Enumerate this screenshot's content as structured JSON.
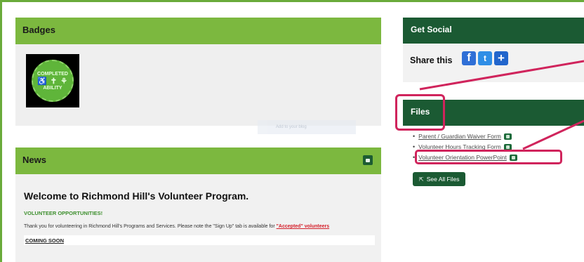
{
  "badges": {
    "title": "Badges",
    "badge_top_text": "COMPLETED",
    "badge_glyphs": "♿ ✝ ⚘",
    "badge_bottom_text": "ABILITY",
    "faded_button": "Add to your blog"
  },
  "news": {
    "title": "News",
    "headline": "Welcome to Richmond Hill's Volunteer Program.",
    "section_label": "VOLUNTEER OPPORTUNITIES!",
    "body_text": "Thank you for volunteering in Richmond Hill's Programs and Services. Please note the \"Sign Up\" tab is available for ",
    "accepted_link": "\"Accepted\" volunteers",
    "coming_soon": "COMING SOON"
  },
  "social": {
    "title": "Get Social",
    "share_label": "Share this",
    "facebook_glyph": "f",
    "twitter_glyph": "t",
    "add_glyph": "+"
  },
  "files": {
    "title": "Files",
    "items": [
      {
        "label": "Parent / Guardian Waiver Form"
      },
      {
        "label": "Volunteer Hours Tracking Form"
      },
      {
        "label": "Volunteer Orientation PowerPoint"
      }
    ],
    "see_all_label": "See All Files"
  },
  "colors": {
    "green_header": "#7cb83f",
    "dark_green_header": "#1b5a33",
    "annotation_pink": "#d0245c"
  }
}
